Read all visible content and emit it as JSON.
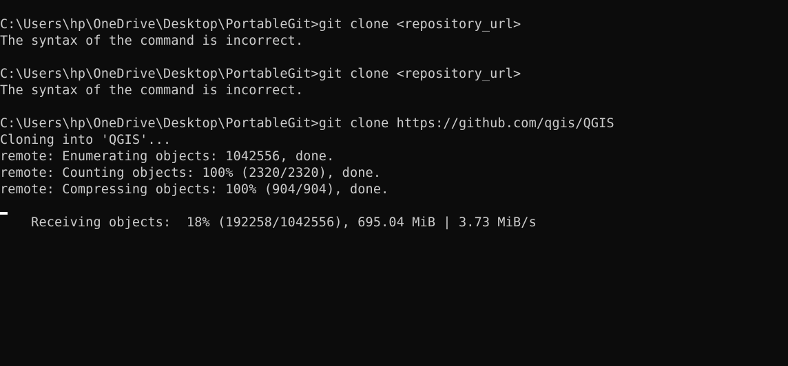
{
  "console": {
    "lines": [
      "C:\\Users\\hp\\OneDrive\\Desktop\\PortableGit>git clone <repository_url>",
      "The syntax of the command is incorrect.",
      "",
      "C:\\Users\\hp\\OneDrive\\Desktop\\PortableGit>git clone <repository_url>",
      "The syntax of the command is incorrect.",
      "",
      "C:\\Users\\hp\\OneDrive\\Desktop\\PortableGit>git clone https://github.com/qgis/QGIS",
      "Cloning into 'QGIS'...",
      "remote: Enumerating objects: 1042556, done.",
      "remote: Counting objects: 100% (2320/2320), done.",
      "remote: Compressing objects: 100% (904/904), done.",
      "Receiving objects:  18% (192258/1042556), 695.04 MiB | 3.73 MiB/s"
    ]
  },
  "colors": {
    "background": "#0c0c0c",
    "foreground": "#cccccc",
    "cursor": "#ffffff"
  }
}
